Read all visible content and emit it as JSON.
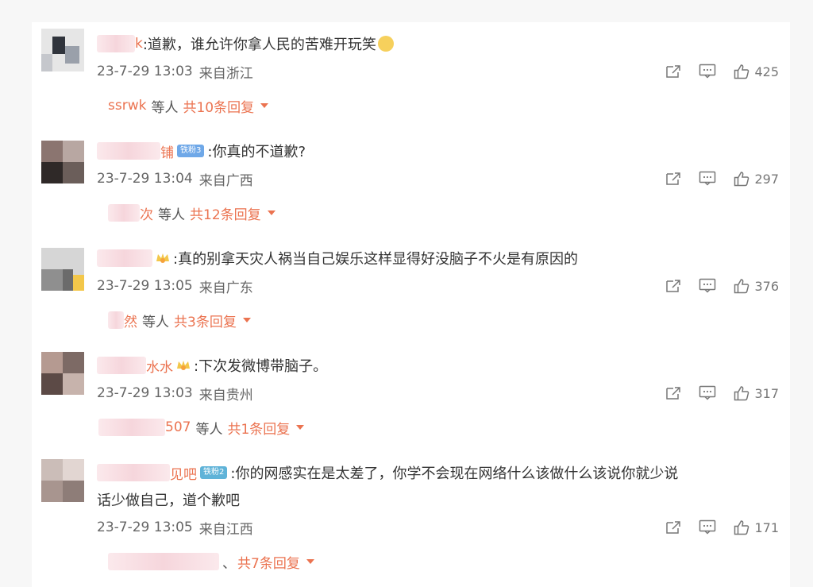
{
  "comments": [
    {
      "username_tail": "k",
      "text": ":道歉，谁允许你拿人民的苦难开玩笑",
      "time": "23-7-29 13:03",
      "location": "来自浙江",
      "likes": "425",
      "reply_users": "ssrwk",
      "reply_etc": "等人",
      "reply_count": "共10条回复",
      "avatar_colors": [
        "#d8d8d8",
        "#3b3f48",
        "#b9bcc4",
        "#8d929c"
      ]
    },
    {
      "username_tail": "铺",
      "badge": "铁粉3",
      "text": ":你真的不道歉?",
      "time": "23-7-29 13:04",
      "location": "来自广西",
      "likes": "297",
      "reply_users": "次",
      "reply_etc": "等人",
      "reply_count": "共12条回复",
      "avatar_colors": [
        "#6d5b56",
        "#2e2a2a",
        "#a79590",
        "#c9bdb8"
      ]
    },
    {
      "username_tail": "",
      "text": ":真的别拿天灾人祸当自己娱乐这样显得好没脑子不火是有原因的",
      "time": "23-7-29 13:05",
      "location": "来自广东",
      "likes": "376",
      "reply_users": "然",
      "reply_etc": "等人",
      "reply_count": "共3条回复",
      "avatar_colors": [
        "#bfbfbf",
        "#8f8f8f",
        "#f3c74a",
        "#6b6b6b"
      ]
    },
    {
      "username_tail": "水水",
      "text": ":下次发微博带脑子。",
      "time": "23-7-29 13:03",
      "location": "来自贵州",
      "likes": "317",
      "reply_users": "507",
      "reply_etc": "等人",
      "reply_count": "共1条回复",
      "avatar_colors": [
        "#a98f86",
        "#5c4a46",
        "#8a7a74",
        "#c7b3ac"
      ]
    },
    {
      "username_tail": "见吧",
      "badge": "铁粉2",
      "text": ":你的网感实在是太差了，你学不会现在网络什么该做什么该说你就少说",
      "text2": "话少做自己，道个歉吧",
      "time": "23-7-29 13:05",
      "location": "来自江西",
      "likes": "171",
      "reply_users": "",
      "reply_etc": "、",
      "reply_count": "共7条回复",
      "avatar_colors": [
        "#b9a8a2",
        "#d3c4bf",
        "#8e7d78",
        "#e2d6d2"
      ]
    }
  ],
  "icons": [
    "share-icon",
    "comment-icon",
    "like-icon",
    "reply-expand-caret-icon"
  ],
  "accent_color": "#eb7350"
}
